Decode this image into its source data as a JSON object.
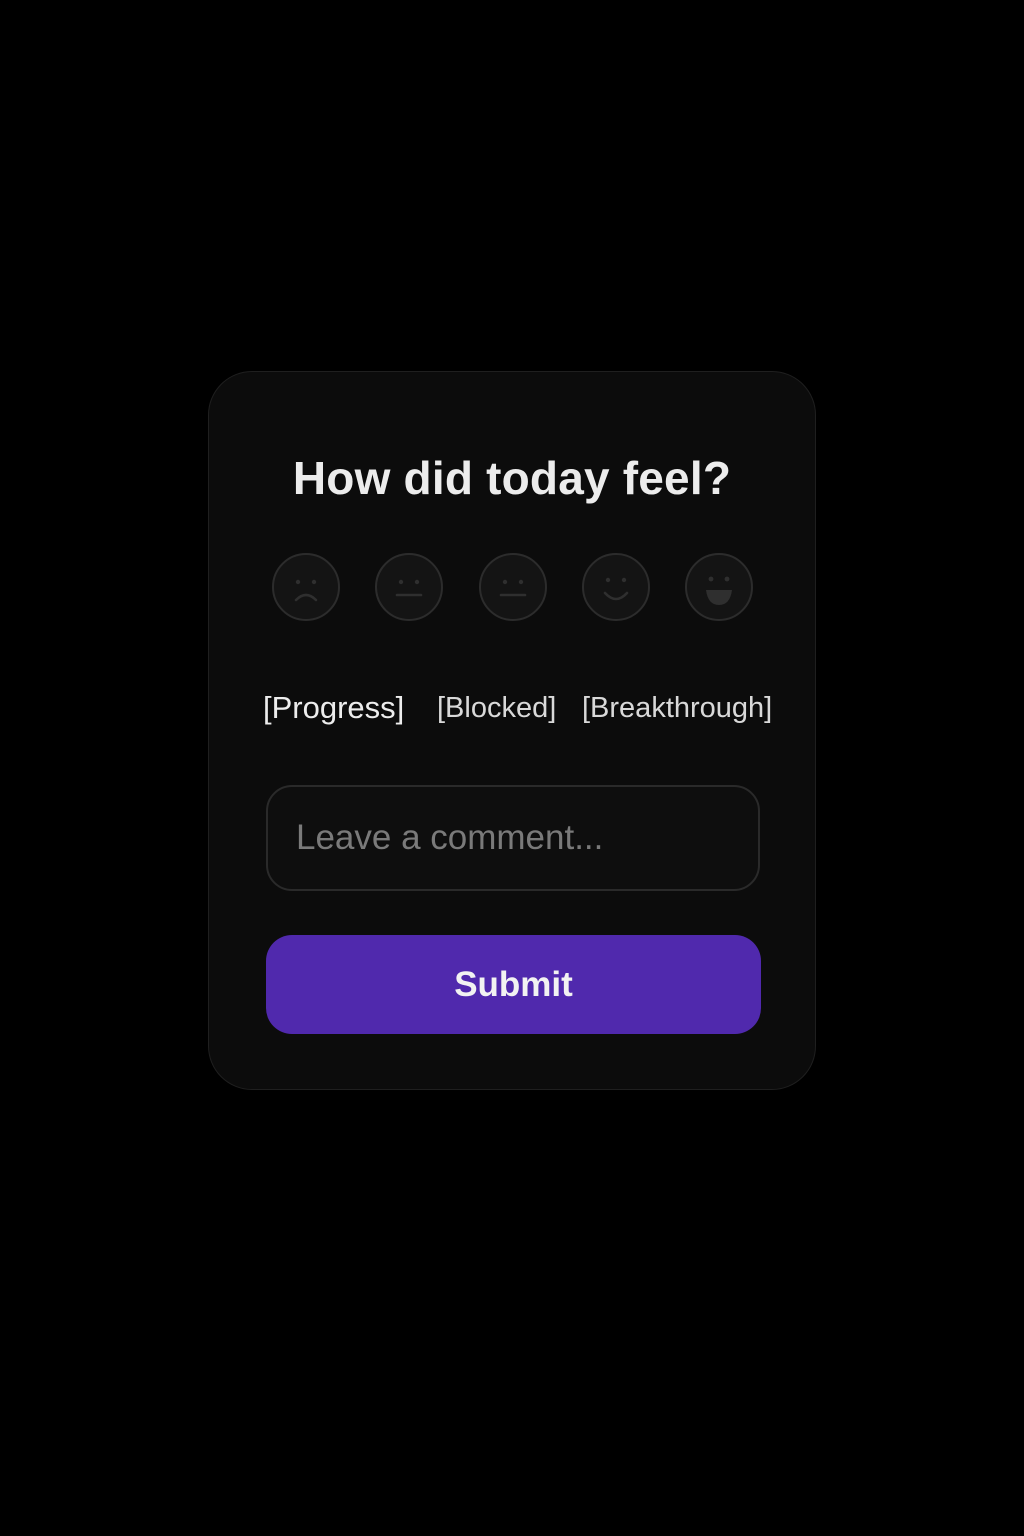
{
  "form": {
    "title": "How did today feel?",
    "moods": [
      {
        "icon": "sad-face-icon"
      },
      {
        "icon": "neutral-face-icon"
      },
      {
        "icon": "neutral-face-icon"
      },
      {
        "icon": "smile-face-icon"
      },
      {
        "icon": "grin-face-icon"
      }
    ],
    "tags": [
      {
        "label": "[Progress]"
      },
      {
        "label": "[Blocked]"
      },
      {
        "label": "[Breakthrough]"
      }
    ],
    "comment": {
      "placeholder": "Leave a comment...",
      "value": ""
    },
    "submit_label": "Submit"
  },
  "colors": {
    "background": "#000000",
    "card": "#0c0c0c",
    "accent": "#5029ad",
    "icon_stroke": "#2e2e2e"
  }
}
